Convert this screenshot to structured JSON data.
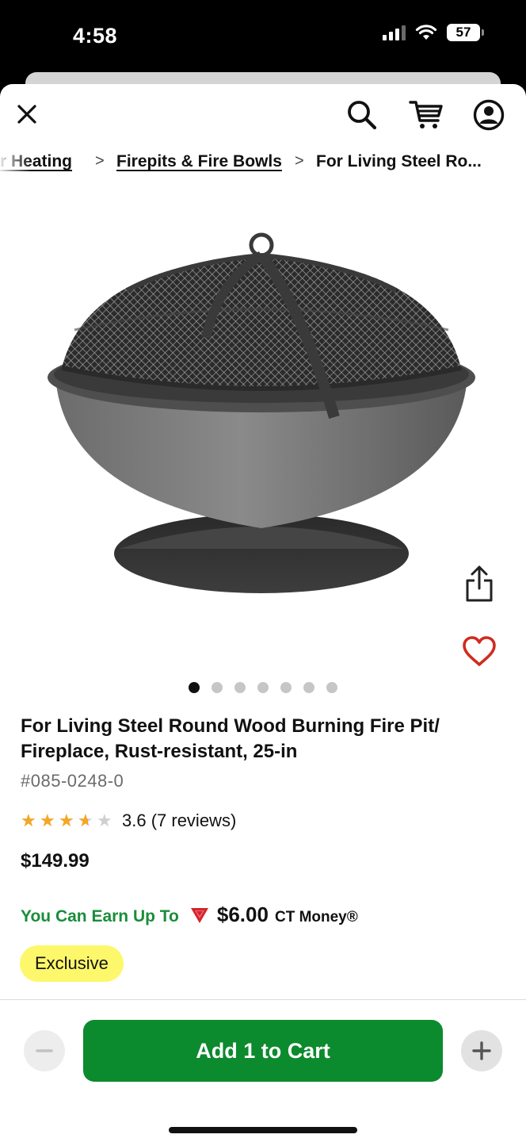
{
  "status_bar": {
    "time": "4:58",
    "battery": "57",
    "icons": [
      "cellular-signal-icon",
      "wifi-icon",
      "battery-icon"
    ]
  },
  "header": {
    "close_icon": "close-icon",
    "search_icon": "search-icon",
    "cart_icon": "cart-icon",
    "account_icon": "account-icon"
  },
  "breadcrumb": {
    "items": [
      "Outdoor Heating",
      "Firepits & Fire Bowls"
    ],
    "visible_first": "r Heating",
    "separator": ">",
    "current": "For Living Steel Ro..."
  },
  "gallery": {
    "image_count": 7,
    "active_index": 0,
    "share_icon": "share-icon",
    "wishlist_icon": "heart-icon"
  },
  "product": {
    "title": "For Living Steel Round Wood Burning Fire Pit/ Fireplace, Rust-resistant, 25-in",
    "sku": "#085-0248-0",
    "rating_value": 3.6,
    "rating_max": 5,
    "rating_text": "3.6 (7 reviews)",
    "price": "$149.99"
  },
  "rewards": {
    "label": "You Can Earn Up To",
    "amount": "$6.00",
    "currency_label": "CT Money®",
    "logo_icon": "canadian-tire-triangle-icon",
    "label_color": "#1a8d3a"
  },
  "badge": {
    "label": "Exclusive",
    "color": "#fdf86b"
  },
  "cart_bar": {
    "button_label": "Add 1 to Cart",
    "button_color": "#0c8a2e",
    "quantity": 1,
    "minus_icon": "minus-icon",
    "plus_icon": "plus-icon"
  }
}
